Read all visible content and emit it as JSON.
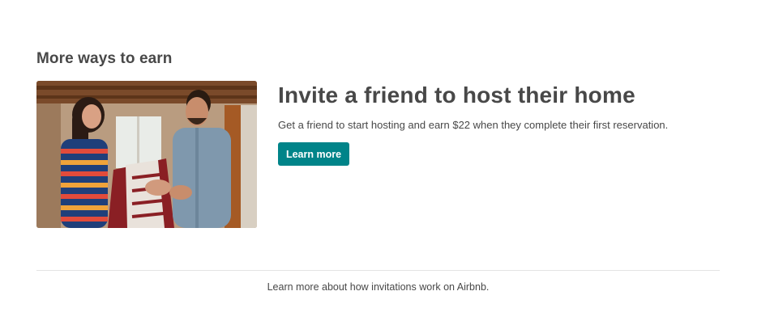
{
  "section": {
    "title": "More ways to earn"
  },
  "promo": {
    "headline": "Invite a friend to host their home",
    "description": "Get a friend to start hosting and earn $22 when they complete their first reservation.",
    "cta_label": "Learn more",
    "image_icon": "photo-two-people-folding-blanket"
  },
  "footer": {
    "link_text": "Learn more about how invitations work on Airbnb."
  },
  "colors": {
    "accent": "#008489",
    "text": "#484848",
    "divider": "#e4e4e4"
  }
}
